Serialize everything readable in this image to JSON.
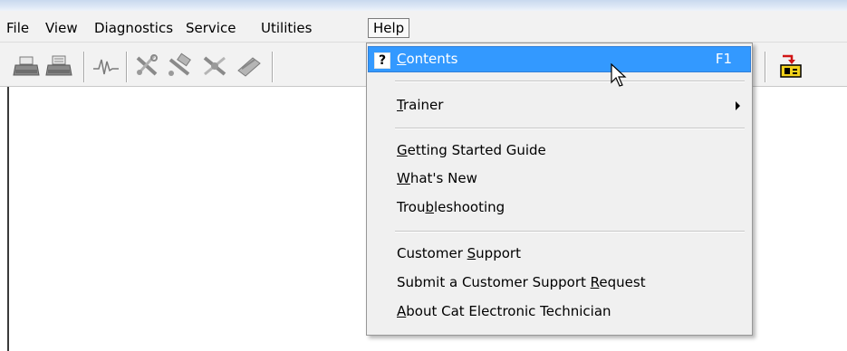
{
  "menubar": {
    "items": [
      {
        "label": "File"
      },
      {
        "label": "View"
      },
      {
        "label": "Diagnostics"
      },
      {
        "label": "Service"
      },
      {
        "label": "Utilities"
      },
      {
        "label": "Help"
      }
    ]
  },
  "help_menu": {
    "contents": {
      "pre": "",
      "mnemonic": "C",
      "post": "ontents",
      "shortcut": "F1",
      "icon": "question-icon"
    },
    "trainer": {
      "pre": "",
      "mnemonic": "T",
      "post": "rainer"
    },
    "getting_started": {
      "pre": "",
      "mnemonic": "G",
      "post": "etting Started Guide"
    },
    "whats_new": {
      "pre": "",
      "mnemonic": "W",
      "post": "hat's New"
    },
    "troubleshooting": {
      "pre": "Trou",
      "mnemonic": "b",
      "post": "leshooting"
    },
    "customer_support": {
      "pre": "Customer ",
      "mnemonic": "S",
      "post": "upport"
    },
    "submit_request": {
      "pre": "Submit a Customer Support ",
      "mnemonic": "R",
      "post": "equest"
    },
    "about": {
      "pre": "",
      "mnemonic": "A",
      "post": "bout Cat Electronic Technician"
    }
  },
  "toolbar": {
    "icons": [
      "print-icon",
      "print-preview-icon",
      "waveform-icon",
      "diagnostic-test-icon",
      "diagnostic-test-2-icon",
      "diagnostic-test-3-icon",
      "diagnostic-test-4-icon",
      "connect-arrows-icon",
      "ecm-module-icon"
    ]
  },
  "colors": {
    "highlight": "#3399ff",
    "menubar_bg": "#f2f2f2",
    "menu_bg": "#f0f0f0"
  }
}
